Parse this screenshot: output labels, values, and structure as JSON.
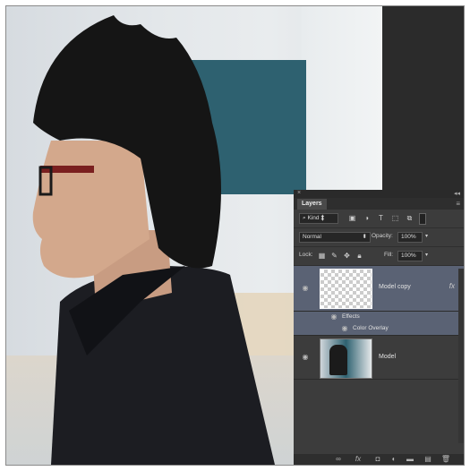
{
  "panel": {
    "close_glyph": "×",
    "collapse_glyph": "◂◂",
    "tab_label": "Layers",
    "menu_glyph": "≡",
    "filter": {
      "kind_label": "Kind"
    },
    "blend": {
      "mode": "Normal",
      "opacity_label": "Opacity:",
      "opacity_value": "100%"
    },
    "lock": {
      "label": "Lock:",
      "fill_label": "Fill:",
      "fill_value": "100%"
    },
    "layers": [
      {
        "name": "Model copy",
        "selected": true,
        "fx": "fx",
        "effects_label": "Effects",
        "effects": [
          "Color Overlay"
        ]
      },
      {
        "name": "Model",
        "selected": false
      }
    ]
  },
  "icons": {
    "filter_icons": [
      "image-filter-icon",
      "adjustment-filter-icon",
      "type-filter-icon",
      "shape-filter-icon",
      "smart-object-filter-icon",
      "filter-toggle-icon"
    ],
    "lock_icons": [
      "lock-transparent-icon",
      "lock-paint-icon",
      "lock-move-icon",
      "lock-all-icon"
    ],
    "bottom_icons": [
      "link-icon",
      "fx-icon",
      "mask-icon",
      "adjustment-icon",
      "group-icon",
      "new-layer-icon",
      "delete-icon"
    ]
  }
}
